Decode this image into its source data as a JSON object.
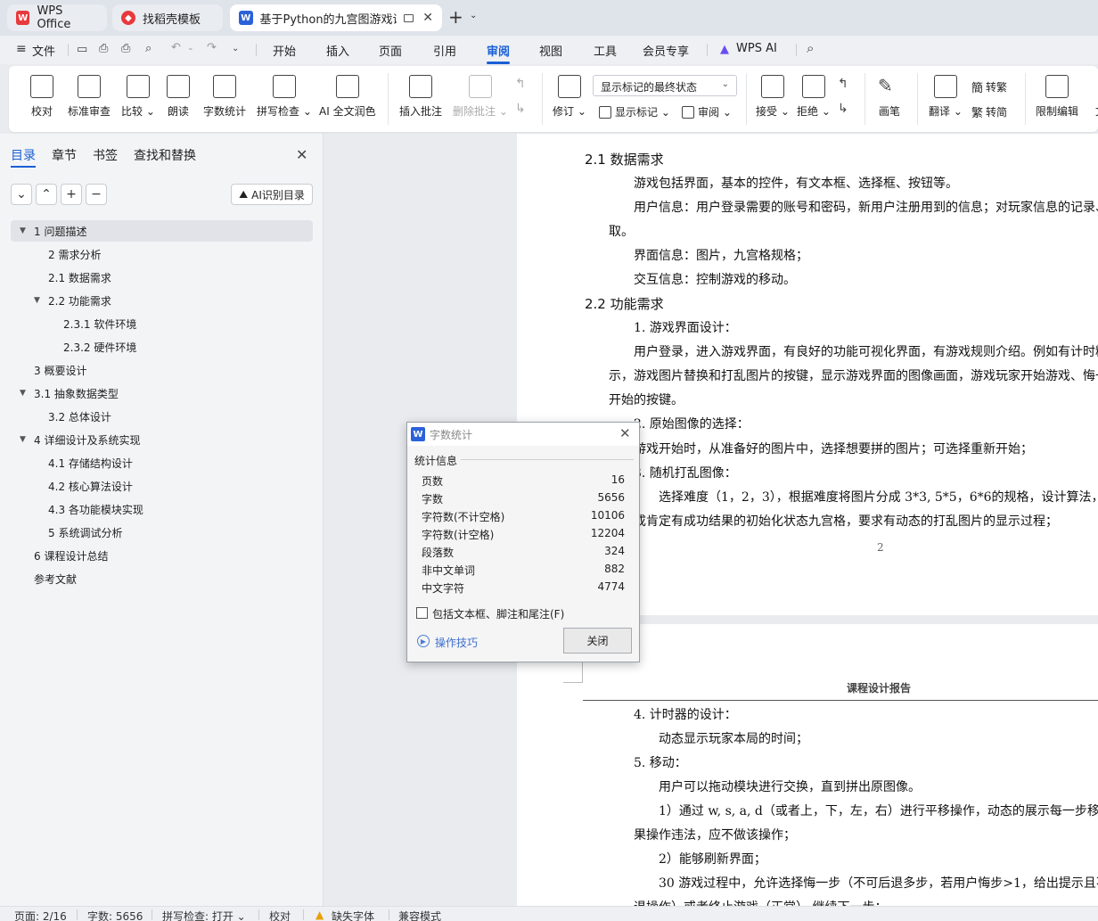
{
  "tabs": [
    {
      "label": "WPS Office",
      "icon": "wps-logo-icon"
    },
    {
      "label": "找稻壳模板",
      "icon": "docer-icon"
    },
    {
      "label": "基于Python的九宫图游戏设计",
      "icon": "writer-w-icon"
    }
  ],
  "menu": {
    "file": "文件",
    "items": [
      "开始",
      "插入",
      "页面",
      "引用",
      "审阅",
      "视图",
      "工具",
      "会员专享"
    ],
    "active": "审阅",
    "wps_ai": "WPS AI"
  },
  "ribbon": {
    "proofread": "校对",
    "standard_review": "标准审查",
    "compare": "比较",
    "read_aloud": "朗读",
    "word_count": "字数统计",
    "spell_check": "拼写检查",
    "ai_polish": "AI 全文润色",
    "insert_comment": "插入批注",
    "delete_comment": "删除批注",
    "revise": "修订",
    "markup_mode": "显示标记的最终状态",
    "show_markup": "显示标记",
    "review": "审阅",
    "accept": "接受",
    "reject": "拒绝",
    "pen": "画笔",
    "translate": "翻译",
    "to_traditional": "转繁",
    "to_simplified": "转简",
    "restrict_edit": "限制编辑",
    "more": "文"
  },
  "nav": {
    "tabs": [
      "目录",
      "章节",
      "书签",
      "查找和替换"
    ],
    "ai_toc": "AI识别目录",
    "toc": [
      {
        "label": "1  问题描述",
        "level": 0,
        "expand": "▼",
        "selected": true
      },
      {
        "label": "2  需求分析",
        "level": 1,
        "expand": ""
      },
      {
        "label": "2.1  数据需求",
        "level": 1,
        "expand": ""
      },
      {
        "label": "2.2  功能需求",
        "level": 1,
        "expand": "▼"
      },
      {
        "label": "2.3.1 软件环境",
        "level": 2,
        "expand": ""
      },
      {
        "label": "2.3.2 硬件环境",
        "level": 2,
        "expand": ""
      },
      {
        "label": "3  概要设计",
        "level": 0,
        "expand": ""
      },
      {
        "label": "3.1 抽象数据类型",
        "level": 0,
        "expand": "▼"
      },
      {
        "label": "3.2  总体设计",
        "level": 1,
        "expand": ""
      },
      {
        "label": "4  详细设计及系统实现",
        "level": 0,
        "expand": "▼"
      },
      {
        "label": "4.1  存储结构设计",
        "level": 1,
        "expand": ""
      },
      {
        "label": "4.2  核心算法设计",
        "level": 1,
        "expand": ""
      },
      {
        "label": "4.3  各功能模块实现",
        "level": 1,
        "expand": ""
      },
      {
        "label": "5  系统调试分析",
        "level": 1,
        "expand": ""
      },
      {
        "label": "6  课程设计总结",
        "level": 0,
        "expand": ""
      },
      {
        "label": "参考文献",
        "level": 0,
        "expand": ""
      }
    ]
  },
  "doc": {
    "page1": {
      "h21": "2.1  数据需求",
      "p1": "游戏包括界面，基本的控件，有文本框、选择框、按钮等。",
      "p2": "用户信息：用户登录需要的账号和密码，新用户注册用到的信息；对玩家信息的记录、",
      "p2b": "取。",
      "p3": "界面信息：图片，九宫格规格；",
      "p4": "交互信息：控制游戏的移动。",
      "h22": "2.2  功能需求",
      "l1": "1. 游戏界面设计：",
      "p5": "用户登录，进入游戏界面，有良好的功能可视化界面，有游戏规则介绍。例如有计时精",
      "p5b": "示，游戏图片替换和打乱图片的按键，显示游戏界面的图像画面，游戏玩家开始游戏、悔一",
      "p5c": "开始的按键。",
      "l2": "2. 原始图像的选择：",
      "p6": "游戏开始时，从准备好的图片中，选择想要拼的图片；可选择重新开始；",
      "l3": "3. 随机打乱图像：",
      "p7": "选择难度（1，2，3），根据难度将图片分成 3*3, 5*5，6*6的规格，设计算法，随",
      "p7b": "成肯定有成功结果的初始化状态九宫格，要求有动态的打乱图片的显示过程；",
      "page_num": "2"
    },
    "page2": {
      "header": "课程设计报告",
      "l4": "4. 计时器的设计：",
      "p8": "动态显示玩家本局的时间；",
      "l5": "5. 移动：",
      "p9": "用户可以拖动模块进行交换，直到拼出原图像。",
      "p10": "1）通过 w, s, a, d（或者上，下，左，右）进行平移操作，动态的展示每一步移动的",
      "p10b": "果操作违法，应不做该操作；",
      "p11": "2）能够刷新界面；",
      "p12": "30 游戏过程中，允许选择悔一步（不可后退多步，若用户悔步>1，给出提示且不执",
      "p12b": "退操作）或者终止游戏（正常）  继续下一步；"
    }
  },
  "dialog": {
    "title": "字数统计",
    "group": "统计信息",
    "stats": [
      {
        "name": "页数",
        "value": "16"
      },
      {
        "name": "字数",
        "value": "5656"
      },
      {
        "name": "字符数(不计空格)",
        "value": "10106"
      },
      {
        "name": "字符数(计空格)",
        "value": "12204"
      },
      {
        "name": "段落数",
        "value": "324"
      },
      {
        "name": "非中文单词",
        "value": "882"
      },
      {
        "name": "中文字符",
        "value": "4774"
      }
    ],
    "checkbox_label": "包括文本框、脚注和尾注(F)",
    "tips": "操作技巧",
    "close_button": "关闭"
  },
  "status": {
    "page": "页面: 2/16",
    "words": "字数: 5656",
    "spell": "拼写检查: 打开",
    "proof": "校对",
    "missing_font": "缺失字体",
    "compat": "兼容模式"
  },
  "colors": {
    "accent": "#1a5fd6",
    "wps_red": "#e8393d",
    "writer_blue": "#2b61d9"
  }
}
